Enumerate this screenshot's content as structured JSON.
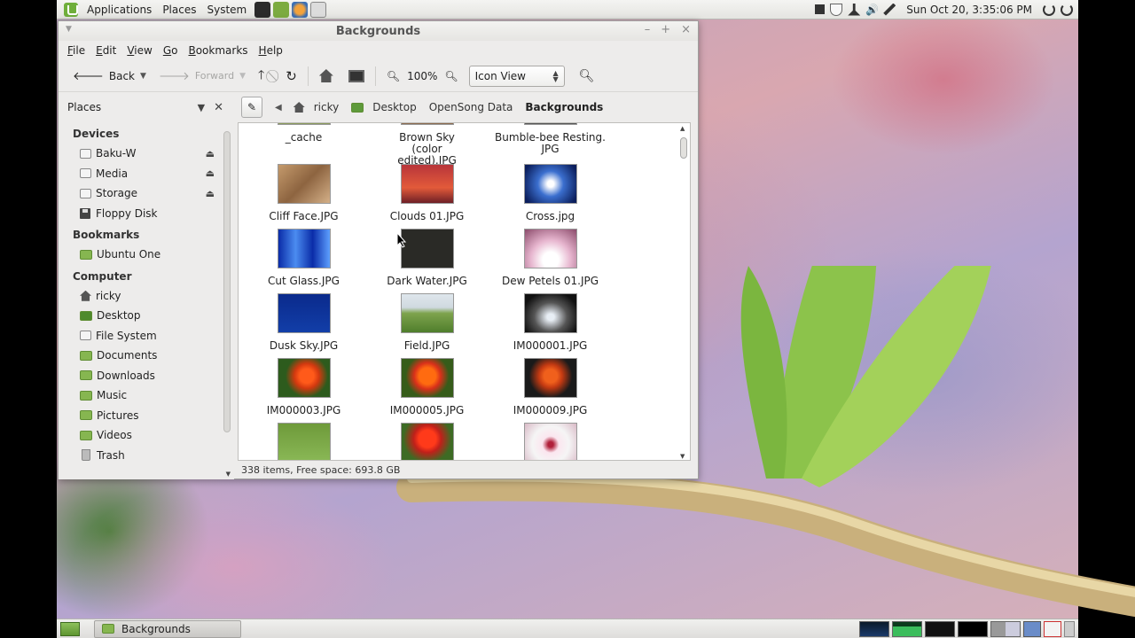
{
  "top_panel": {
    "menus": [
      "Applications",
      "Places",
      "System"
    ],
    "clock": "Sun Oct 20,  3:35:06 PM"
  },
  "window": {
    "title": "Backgrounds",
    "menubar": [
      "File",
      "Edit",
      "View",
      "Go",
      "Bookmarks",
      "Help"
    ],
    "toolbar": {
      "back": "Back",
      "forward": "Forward",
      "zoom": "100%",
      "view_mode": "Icon View"
    },
    "sidebar_header": "Places",
    "breadcrumbs": [
      "ricky",
      "Desktop",
      "OpenSong Data",
      "Backgrounds"
    ],
    "sidebar": {
      "devices_title": "Devices",
      "devices": [
        "Baku-W",
        "Media",
        "Storage",
        "Floppy Disk"
      ],
      "bookmarks_title": "Bookmarks",
      "bookmarks": [
        "Ubuntu One"
      ],
      "computer_title": "Computer",
      "computer": [
        "ricky",
        "Desktop",
        "File System",
        "Documents",
        "Downloads",
        "Music",
        "Pictures",
        "Videos",
        "Trash"
      ]
    },
    "files": [
      [
        "_cache",
        "Brown Sky (color edited).JPG",
        "Bumble-bee Resting.\nJPG"
      ],
      [
        "Cliff Face.JPG",
        "Clouds 01.JPG",
        "Cross.jpg"
      ],
      [
        "Cut Glass.JPG",
        "Dark Water.JPG",
        "Dew Petels 01.JPG"
      ],
      [
        "Dusk Sky.JPG",
        "Field.JPG",
        "IM000001.JPG"
      ],
      [
        "IM000003.JPG",
        "IM000005.JPG",
        "IM000009.JPG"
      ],
      [
        "",
        "",
        ""
      ]
    ],
    "status": "338 items, Free space: 693.8 GB"
  },
  "bottom_panel": {
    "task": "Backgrounds"
  }
}
